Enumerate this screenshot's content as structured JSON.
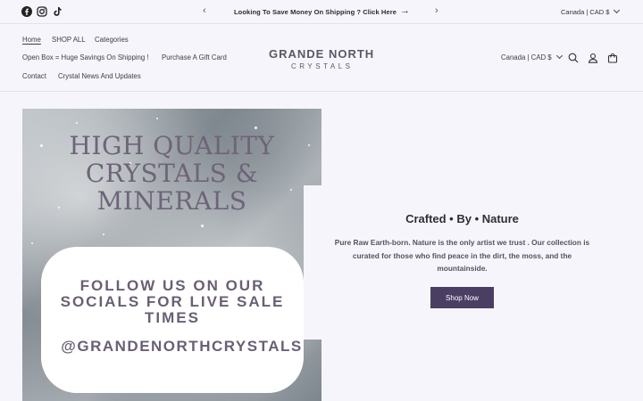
{
  "announcement": {
    "text": "Looking To Save Money On Shipping ? Click Here",
    "go_arrow": "→",
    "prev_arrow": "‹",
    "next_arrow": "›",
    "country": "Canada | CAD $"
  },
  "social_icons": [
    "facebook-icon",
    "instagram-icon",
    "tiktok-icon"
  ],
  "nav": {
    "items": [
      {
        "label": "Home",
        "active": true
      },
      {
        "label": "SHOP ALL"
      },
      {
        "label": "Categories"
      },
      {
        "label": "Open Box = Huge Savings On Shipping !"
      },
      {
        "label": "Purchase A Gift Card"
      },
      {
        "label": "Contact"
      },
      {
        "label": "Crystal News And Updates"
      }
    ]
  },
  "logo": {
    "main": "GRANDE NORTH",
    "sub": "CRYSTALS"
  },
  "header": {
    "country": "Canada | CAD $",
    "icons": [
      "search-icon",
      "account-icon",
      "cart-icon"
    ]
  },
  "hero": {
    "image_title": "HIGH QUALITY CRYSTALS & MINERALS",
    "follow_text": "FOLLOW US ON OUR SOCIALS FOR LIVE SALE TIMES",
    "handle": "@GRANDENORTHCRYSTALS",
    "tagline": "Crafted • By • Nature",
    "description": "Pure Raw Earth-born. Nature is the only artist we trust . Our collection is curated for those who find peace in the dirt, the moss, and the mountainside.",
    "button_label": "Shop Now"
  },
  "colors": {
    "background": "#f6f5fb",
    "button": "#4a3f63",
    "text": "#3d3d4a"
  }
}
